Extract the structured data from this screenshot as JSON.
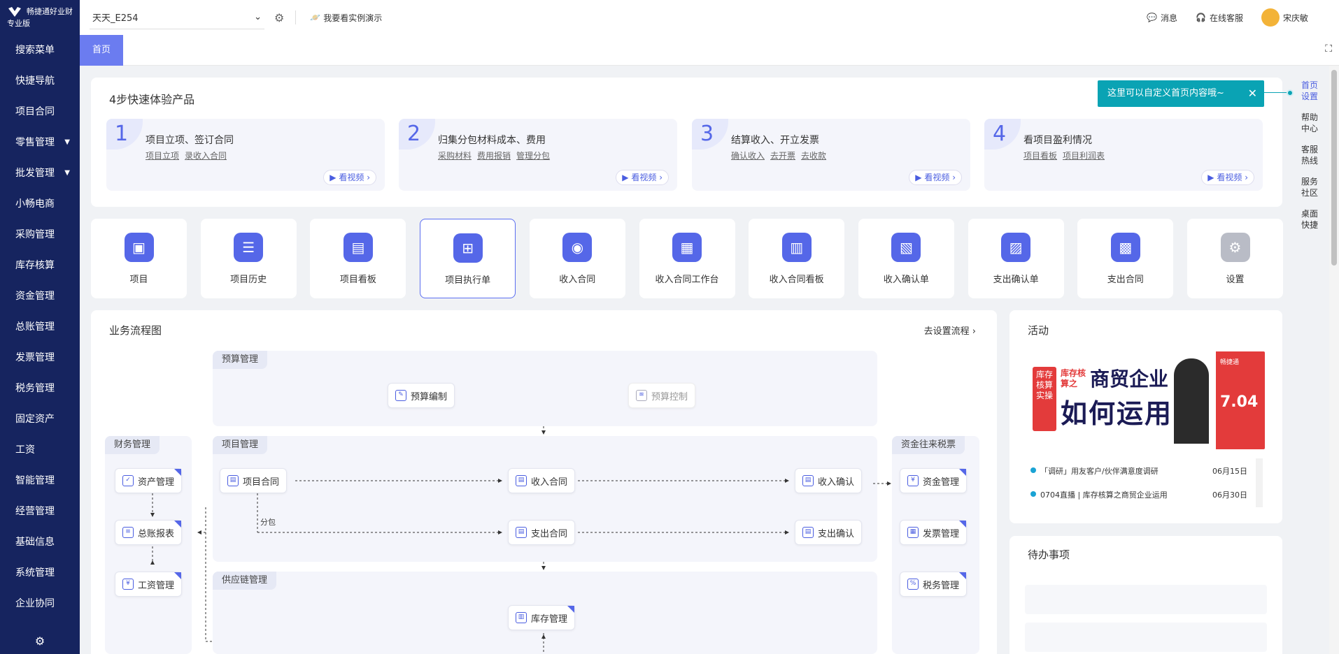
{
  "app": {
    "logo_line1": "畅捷通好业财",
    "logo_line2": "专业版"
  },
  "sidebar": {
    "items": [
      {
        "label": "搜索菜单"
      },
      {
        "label": "快捷导航"
      },
      {
        "label": "项目合同"
      },
      {
        "label": "零售管理",
        "arrow": "▼"
      },
      {
        "label": "批发管理",
        "arrow": "▼"
      },
      {
        "label": "小畅电商"
      },
      {
        "label": "采购管理"
      },
      {
        "label": "库存核算"
      },
      {
        "label": "资金管理"
      },
      {
        "label": "总账管理"
      },
      {
        "label": "发票管理"
      },
      {
        "label": "税务管理"
      },
      {
        "label": "固定资产"
      },
      {
        "label": "工资"
      },
      {
        "label": "智能管理"
      },
      {
        "label": "经营管理"
      },
      {
        "label": "基础信息"
      },
      {
        "label": "系统管理"
      },
      {
        "label": "企业协同"
      }
    ],
    "settings_icon": "gear-icon"
  },
  "topbar": {
    "account": "天天_E254",
    "demo": "我要看实例演示",
    "messages": "消息",
    "service": "在线客服",
    "user": "宋庆敏"
  },
  "tabs": {
    "home": "首页"
  },
  "quick": {
    "title": "4步快速体验产品",
    "video_label": "看视频",
    "steps": [
      {
        "num": "1",
        "title": "项目立项、签订合同",
        "links": [
          "项目立项",
          "录收入合同"
        ]
      },
      {
        "num": "2",
        "title": "归集分包材料成本、费用",
        "links": [
          "采购材料",
          "费用报销",
          "管理分包"
        ]
      },
      {
        "num": "3",
        "title": "结算收入、开立发票",
        "links": [
          "确认收入",
          "去开票",
          "去收款"
        ]
      },
      {
        "num": "4",
        "title": "看项目盈利情况",
        "links": [
          "项目看板",
          "项目利润表"
        ]
      }
    ]
  },
  "tip": {
    "text": "这里可以自定义首页内容哦~",
    "close": "✕"
  },
  "rightnav": [
    {
      "line1": "首页",
      "line2": "设置"
    },
    {
      "line1": "帮助",
      "line2": "中心"
    },
    {
      "line1": "客服",
      "line2": "热线"
    },
    {
      "line1": "服务",
      "line2": "社区"
    },
    {
      "line1": "桌面",
      "line2": "快捷"
    }
  ],
  "tiles": [
    {
      "label": "项目"
    },
    {
      "label": "项目历史"
    },
    {
      "label": "项目看板"
    },
    {
      "label": "项目执行单"
    },
    {
      "label": "收入合同"
    },
    {
      "label": "收入合同工作台"
    },
    {
      "label": "收入合同看板"
    },
    {
      "label": "收入确认单"
    },
    {
      "label": "支出确认单"
    },
    {
      "label": "支出合同"
    },
    {
      "label": "设置"
    }
  ],
  "flow": {
    "title": "业务流程图",
    "settings_link": "去设置流程",
    "zones": {
      "budget": "预算管理",
      "finance": "财务管理",
      "project": "项目管理",
      "supply": "供应链管理",
      "funds": "资金往来税票"
    },
    "nodes": {
      "budget_edit": "预算编制",
      "budget_ctrl": "预算控制",
      "asset": "资产管理",
      "ledger": "总账报表",
      "salary": "工资管理",
      "proj_contract": "项目合同",
      "income_contract": "收入合同",
      "income_confirm": "收入确认",
      "expense_contract": "支出合同",
      "expense_confirm": "支出确认",
      "fund_mgmt": "资金管理",
      "invoice_mgmt": "发票管理",
      "tax_mgmt": "税务管理",
      "inventory": "库存管理",
      "subcontract_label": "分包"
    }
  },
  "activity": {
    "title": "活动",
    "banner": {
      "tag": "库存核算实操",
      "series": "库存核算之",
      "headline1": "商贸企业",
      "headline2": "如何运用",
      "date": "7.04",
      "brand": "畅捷通"
    },
    "news": [
      {
        "text": "「调研」用友客户/伙伴满意度调研",
        "date": "06月15日"
      },
      {
        "text": "0704直播 | 库存核算之商贸企业运用",
        "date": "06月30日"
      }
    ]
  },
  "todo": {
    "title": "待办事项"
  }
}
